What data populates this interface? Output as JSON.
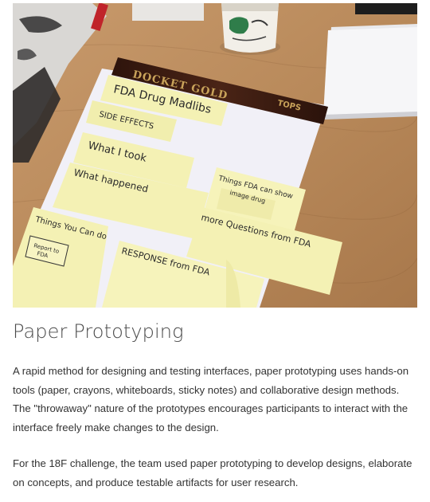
{
  "photo": {
    "pad_header": "DOCKET GOLD",
    "pad_brand": "TOPS",
    "notes": {
      "drug_madlibs": "FDA Drug Madlibs",
      "side_effects": "SIDE EFFECTS",
      "what_i_took": "What I took",
      "what_happened": "What happened",
      "things_fda_line1": "Things FDA can show",
      "things_fda_line2": "image drug",
      "more_questions": "more Questions from FDA",
      "things_you_can_do": "Things You Can do",
      "report_line1": "Report to",
      "report_line2": "FDA",
      "response": "RESPONSE from FDA"
    },
    "colors": {
      "desk": "#b98a5b",
      "sticky": "#f4f1b4",
      "pad": "#f1f0f7",
      "pad_header": "#3b1c12"
    }
  },
  "article": {
    "title": "Paper Prototyping",
    "paragraph1": "A rapid method for designing and testing interfaces, paper prototyping uses hands-on tools (paper, crayons, whiteboards, sticky notes) and collaborative design methods. The \"throwaway\" nature of the prototypes encourages participants to interact with the interface freely make changes to the design.",
    "paragraph2": "For the 18F challenge, the team used paper prototyping to develop designs, elaborate on concepts, and produce testable artifacts for user research."
  }
}
